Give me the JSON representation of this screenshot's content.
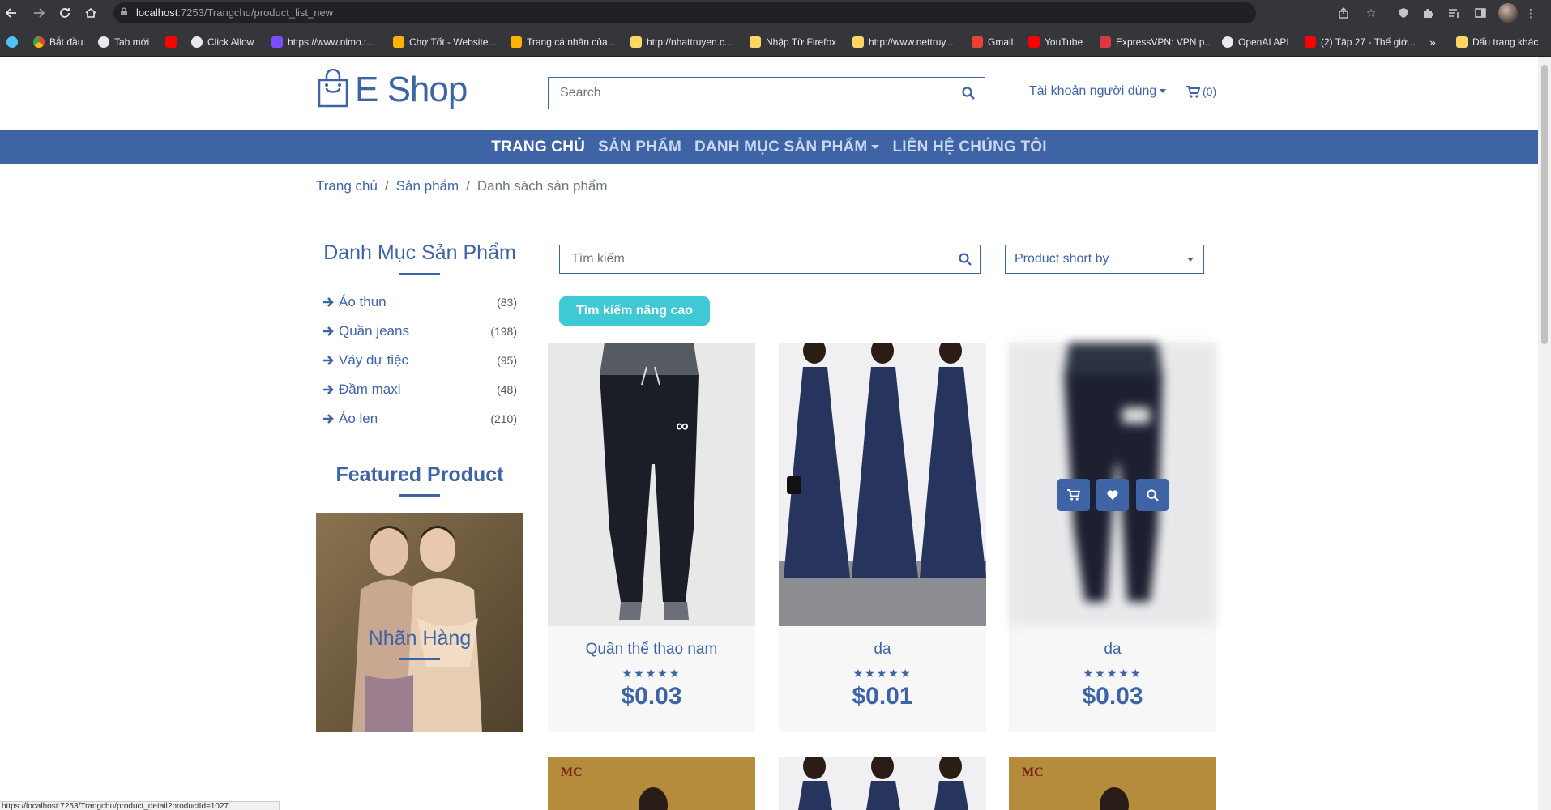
{
  "browser": {
    "url_host": "localhost",
    "url_path": ":7253/Trangchu/product_list_new",
    "bookmarks": [
      {
        "label": "Bắt đầu",
        "icon": "compass-icon",
        "color": "#4fc3f7"
      },
      {
        "label": "Tab mới",
        "icon": "chrome-icon",
        "color": "#4caf50"
      },
      {
        "label": "Click Allow",
        "icon": "globe-icon",
        "color": "#e8eaed"
      },
      {
        "label": "",
        "icon": "youtube-icon",
        "color": "#ff0000"
      },
      {
        "label": "https://www.nimo.t...",
        "icon": "nimo-icon",
        "color": "#7c4dff"
      },
      {
        "label": "Chợ Tốt - Website...",
        "icon": "chotot-icon",
        "color": "#ffb300"
      },
      {
        "label": "Trang cá nhân của...",
        "icon": "chotot-icon",
        "color": "#ffb300"
      },
      {
        "label": "http://nhattruyen.c...",
        "icon": "folder-icon",
        "color": "#fdd663"
      },
      {
        "label": "Nhập Từ Firefox",
        "icon": "folder-icon",
        "color": "#fdd663"
      },
      {
        "label": "http://www.nettruy...",
        "icon": "folder-icon",
        "color": "#fdd663"
      },
      {
        "label": "Gmail",
        "icon": "gmail-icon",
        "color": "#ea4335"
      },
      {
        "label": "YouTube",
        "icon": "youtube-icon",
        "color": "#ff0000"
      },
      {
        "label": "ExpressVPN: VPN p...",
        "icon": "expressvpn-icon",
        "color": "#da3940"
      },
      {
        "label": "OpenAI API",
        "icon": "openai-icon",
        "color": "#e8eaed"
      },
      {
        "label": "(2) Tập 27 - Thế giớ...",
        "icon": "youtube-icon",
        "color": "#ff0000"
      }
    ],
    "overflow_label": "»",
    "bookmarks_folder": "Dấu trang khác",
    "status_url": "https://localhost:7253/Trangchu/product_detail?productId=1027"
  },
  "header": {
    "logo_text": "E Shop",
    "search_placeholder": "Search",
    "account_label": "Tài khoản người dùng",
    "cart_count": "(0)"
  },
  "nav": {
    "items": [
      "TRANG CHỦ",
      "SẢN PHẨM",
      "DANH MỤC SẢN PHẨM",
      "LIÊN HỆ CHÚNG TÔI"
    ]
  },
  "breadcrumb": [
    "Trang chủ",
    "Sản phẩm",
    "Danh sách sản phẩm"
  ],
  "sidebar": {
    "categories_title": "Danh Mục Sản Phẩm",
    "categories": [
      {
        "label": "Áo thun",
        "count": "(83)"
      },
      {
        "label": "Quần jeans",
        "count": "(198)"
      },
      {
        "label": "Váy dự tiệc",
        "count": "(95)"
      },
      {
        "label": "Đầm maxi",
        "count": "(48)"
      },
      {
        "label": "Áo len",
        "count": "(210)"
      }
    ],
    "featured_title": "Featured Product",
    "brands_title": "Nhãn Hàng"
  },
  "products": {
    "search_placeholder": "Tìm kiếm",
    "sort_label": "Product short by",
    "advanced_search_label": "Tìm kiếm nâng cao",
    "items": [
      {
        "name": "Quần thể thao nam",
        "rating": 5,
        "price": "$0.03"
      },
      {
        "name": "da",
        "rating": 5,
        "price": "$0.01"
      },
      {
        "name": "da",
        "rating": 5,
        "price": "$0.03"
      }
    ],
    "next_row_logo": "MC"
  },
  "colors": {
    "brand": "#3e64a6",
    "accent": "#3fc9d5"
  }
}
